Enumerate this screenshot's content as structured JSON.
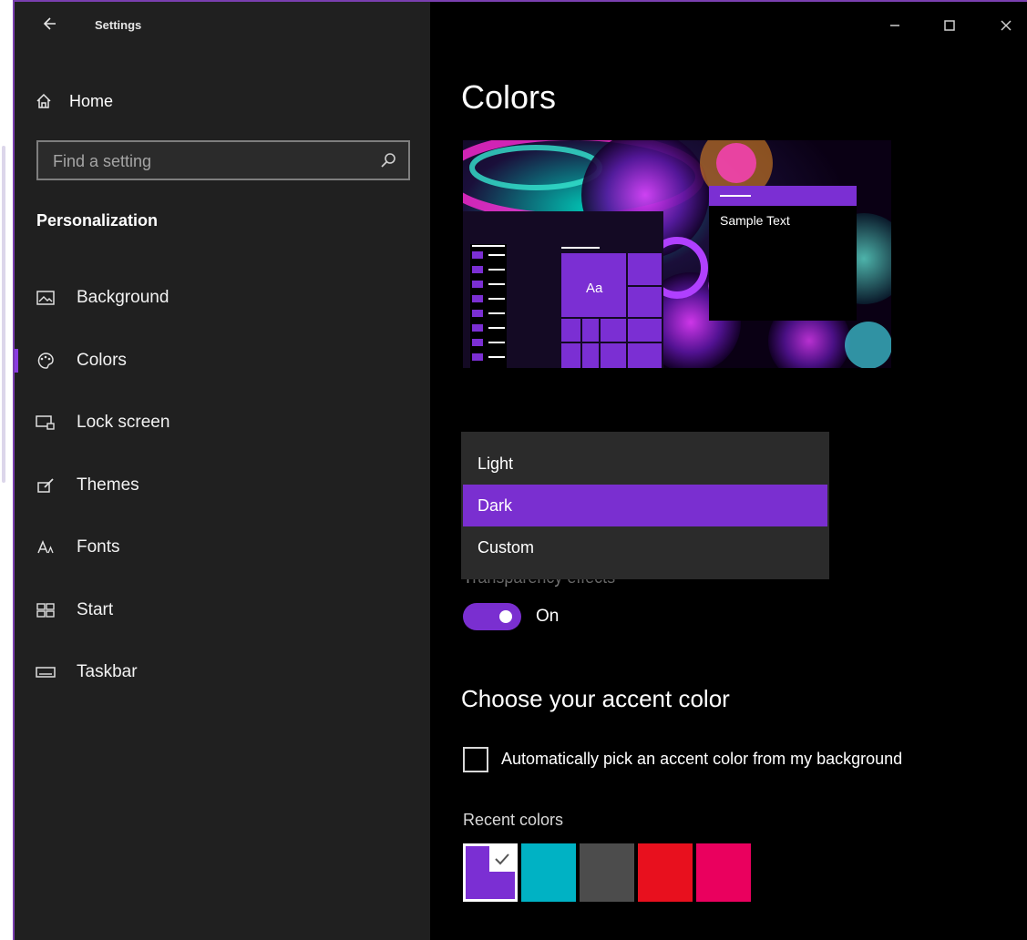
{
  "window": {
    "title": "Settings",
    "back_icon": "back-arrow-icon",
    "controls": [
      "minimize-icon",
      "maximize-icon",
      "close-icon"
    ]
  },
  "sidebar": {
    "home_label": "Home",
    "search_placeholder": "Find a setting",
    "section_heading": "Personalization",
    "items": [
      {
        "label": "Background",
        "icon": "image-icon"
      },
      {
        "label": "Colors",
        "icon": "palette-icon",
        "active": true
      },
      {
        "label": "Lock screen",
        "icon": "lock-screen-icon"
      },
      {
        "label": "Themes",
        "icon": "brush-icon"
      },
      {
        "label": "Fonts",
        "icon": "font-icon"
      },
      {
        "label": "Start",
        "icon": "start-icon"
      },
      {
        "label": "Taskbar",
        "icon": "taskbar-icon"
      }
    ]
  },
  "main": {
    "title": "Colors",
    "preview": {
      "sample_text": "Sample Text",
      "tile_text": "Aa"
    },
    "dropdown": {
      "options": [
        "Light",
        "Dark",
        "Custom"
      ],
      "selected": "Dark"
    },
    "transparency": {
      "label": "Transparency effects",
      "state": "On",
      "enabled": true
    },
    "accent": {
      "heading": "Choose your accent color",
      "auto_pick_label": "Automatically pick an accent color from my background",
      "auto_pick_checked": false,
      "recent_label": "Recent colors",
      "recent_colors": [
        "#7b2fd3",
        "#00b2c4",
        "#4c4c4c",
        "#e8101e",
        "#ea005e"
      ],
      "selected_index": 0
    }
  },
  "colors": {
    "accent": "#7a2fd0",
    "sidebar_bg": "#202020",
    "content_bg": "#000000",
    "window_border": "#7a3fb0"
  }
}
